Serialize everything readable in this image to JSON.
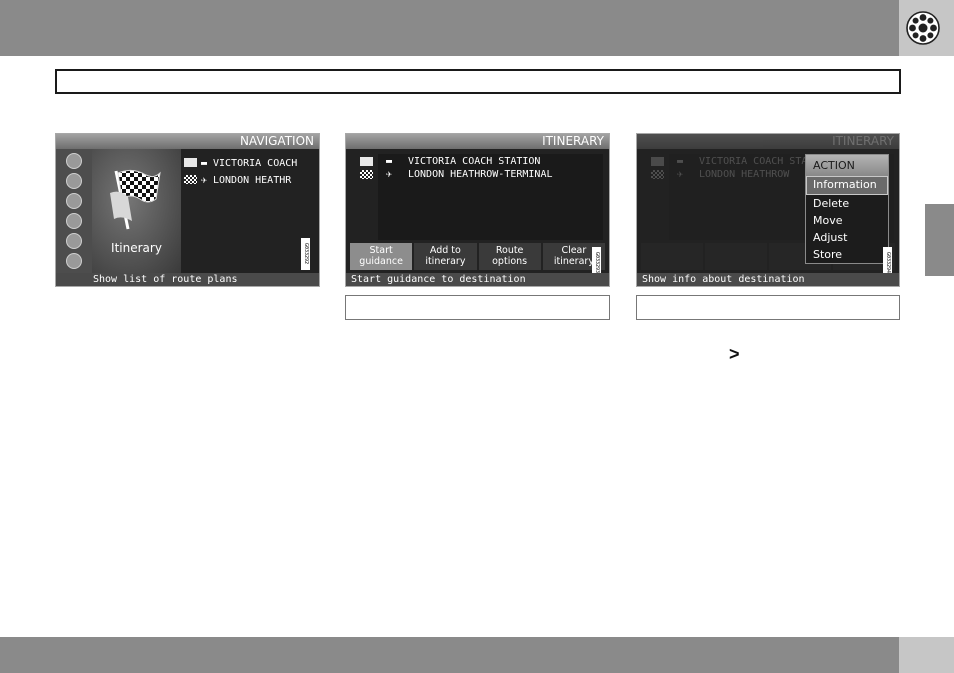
{
  "page": {
    "next_page_marker": ">"
  },
  "icons": {
    "corner_icon": "steering-wheel-icon",
    "rail_icons": [
      "map-icon",
      "home-icon",
      "poi-icon",
      "route-icon",
      "settings-icon",
      "power-icon"
    ],
    "focus_icon": "checkered-flag-icon"
  },
  "colors": {
    "band": "#8a8a8a",
    "band_corner": "#c6c6c6",
    "screen_bg": "#222222",
    "highlight": "#8d8d8d"
  },
  "screens": [
    {
      "title": "NAVIGATION",
      "focus_label": "Itinerary",
      "plans": [
        {
          "icon": "bus-icon",
          "label": "VICTORIA COACH"
        },
        {
          "icon": "airplane-icon",
          "label": "LONDON HEATHR"
        }
      ],
      "status": "Show list of route plans",
      "image_code": "G033292"
    },
    {
      "title": "ITINERARY",
      "stops": [
        {
          "icon": "bus-icon",
          "label": "VICTORIA COACH STATION"
        },
        {
          "icon": "airplane-icon",
          "label": "LONDON HEATHROW-TERMINAL"
        }
      ],
      "softkeys": [
        {
          "label": "Start\nguidance",
          "active": true
        },
        {
          "label": "Add to\nitinerary",
          "active": false
        },
        {
          "label": "Route\noptions",
          "active": false
        },
        {
          "label": "Clear\nitinerary",
          "active": false
        }
      ],
      "status": "Start guidance to destination",
      "image_code": "G033293"
    },
    {
      "title": "ITINERARY",
      "background_stops": [
        "VICTORIA COACH STATION",
        "LONDON HEATHROW"
      ],
      "menu_title": "ACTION",
      "menu_items": [
        "Information",
        "Delete",
        "Move",
        "Adjust",
        "Store"
      ],
      "selected_item": "Information",
      "status": "Show info about destination",
      "image_code": "G033294"
    }
  ]
}
